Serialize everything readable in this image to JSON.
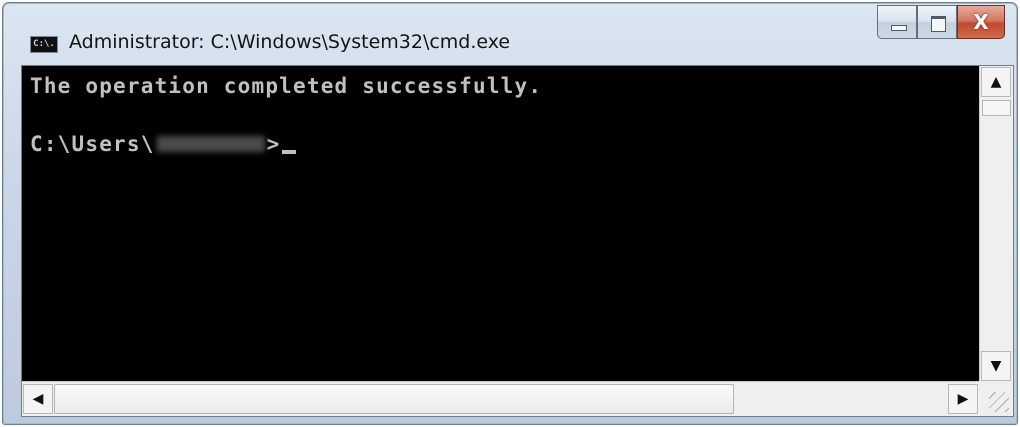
{
  "window": {
    "title": "Administrator: C:\\Windows\\System32\\cmd.exe",
    "app_icon_text": "C:\\."
  },
  "console": {
    "line1": "The operation completed successfully.",
    "prompt_prefix": "C:\\Users\\",
    "prompt_suffix": ">"
  },
  "scrollbars": {
    "up_arrow": "▲",
    "down_arrow": "▼",
    "left_arrow": "◀",
    "right_arrow": "▶"
  },
  "caption_buttons": {
    "close_glyph": "X"
  },
  "colors": {
    "console_bg": "#000000",
    "console_fg": "#c0c0c0",
    "close_button": "#c04a30"
  }
}
